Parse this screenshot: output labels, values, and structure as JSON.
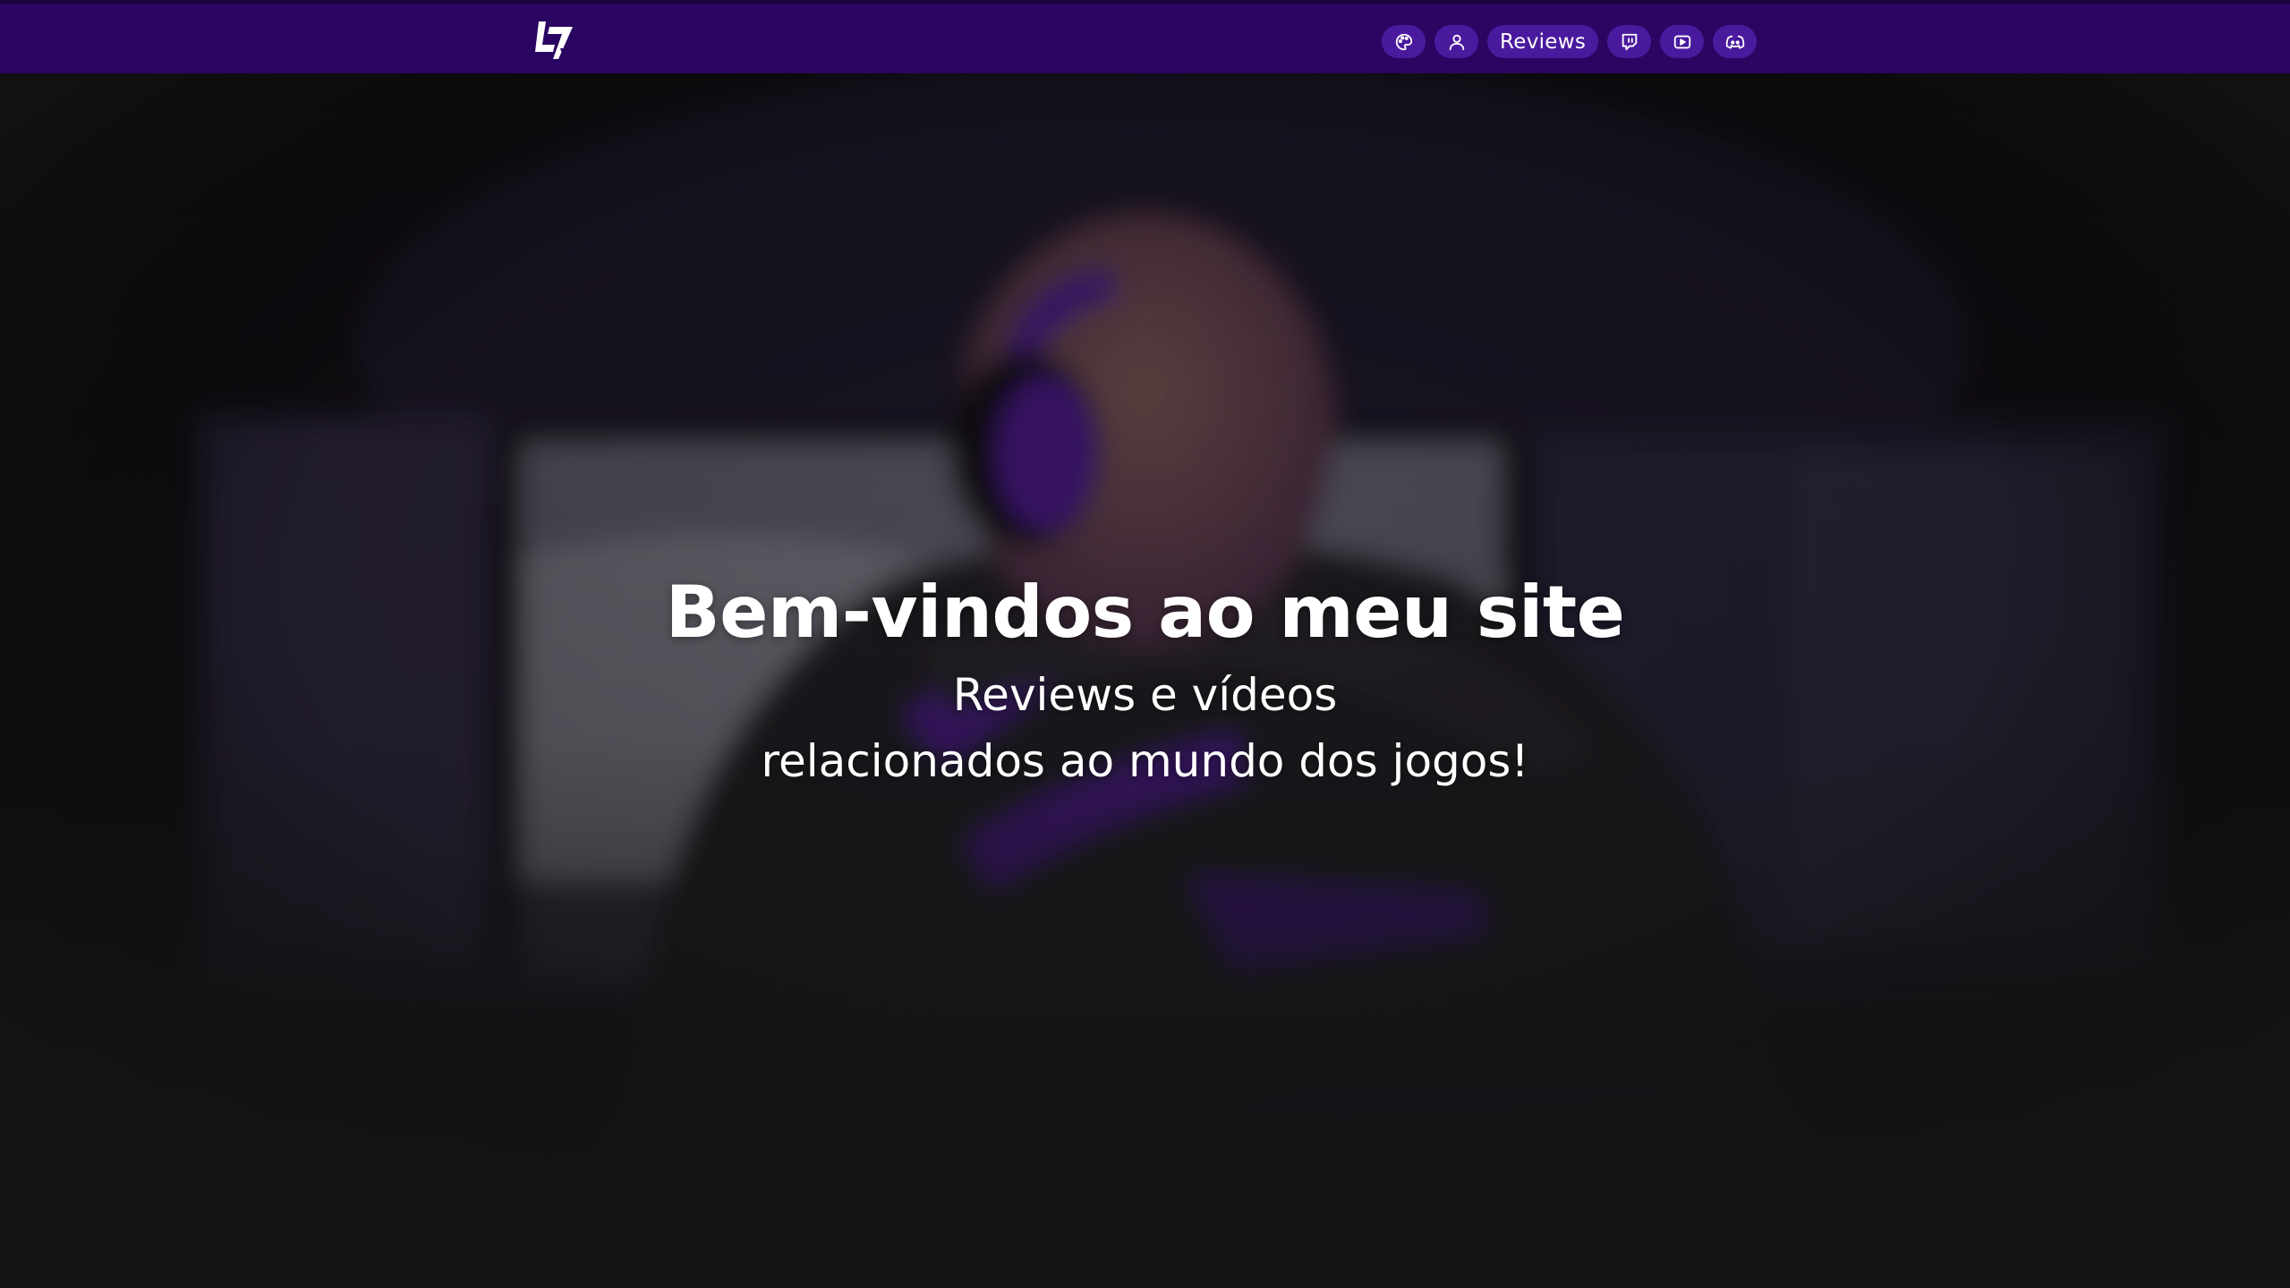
{
  "navbar": {
    "logo_icon": "lv-logo-icon",
    "items": [
      {
        "id": "theme",
        "icon": "palette-icon"
      },
      {
        "id": "about",
        "icon": "user-icon"
      },
      {
        "id": "reviews",
        "label": "Reviews"
      },
      {
        "id": "twitch",
        "icon": "twitch-icon"
      },
      {
        "id": "youtube",
        "icon": "youtube-icon"
      },
      {
        "id": "discord",
        "icon": "discord-icon"
      }
    ]
  },
  "hero": {
    "title": "Bem-vindos ao meu site",
    "subtitle_line1": "Reviews e vídeos",
    "subtitle_line2": "relacionados ao mundo dos jogos!"
  },
  "colors": {
    "navbar": "#2a0562",
    "pill": "#4a1a9e",
    "accent_purple": "#6a22c4",
    "background": "#151515",
    "text": "#ffffff"
  }
}
